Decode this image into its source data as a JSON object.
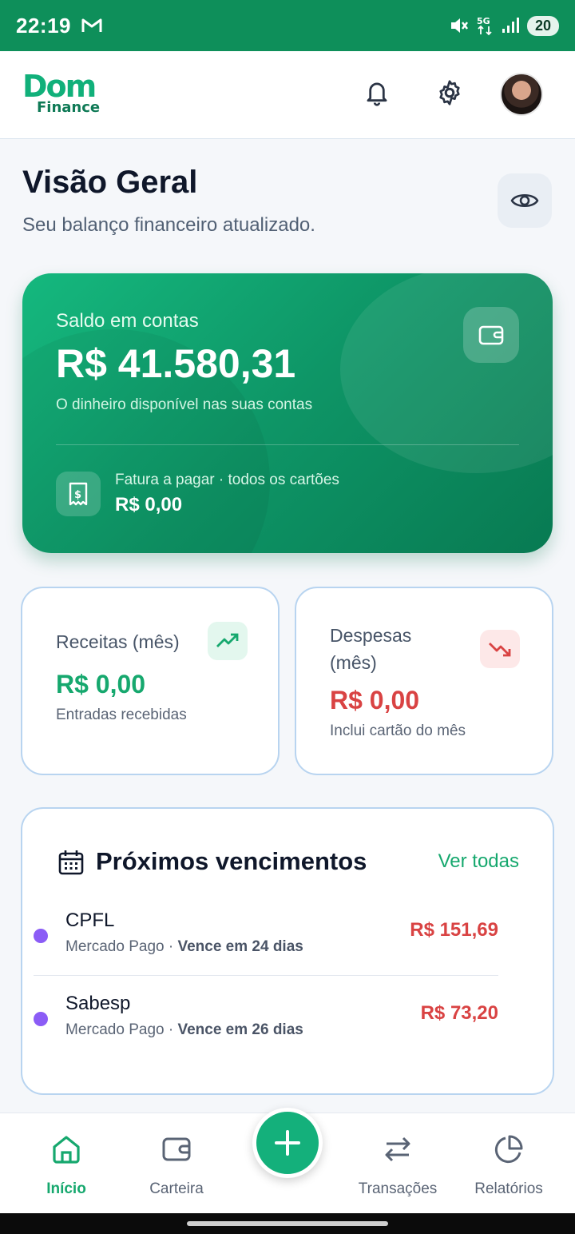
{
  "status_bar": {
    "time": "22:19",
    "battery": "20"
  },
  "header": {
    "logo_top": "Dom",
    "logo_bottom": "Finance"
  },
  "overview": {
    "title": "Visão Geral",
    "subtitle": "Seu balanço financeiro atualizado."
  },
  "balance": {
    "label": "Saldo em contas",
    "value": "R$ 41.580,31",
    "description": "O dinheiro disponível nas suas contas",
    "bill_label": "Fatura a pagar · todos os cartões",
    "bill_value": "R$ 0,00"
  },
  "income": {
    "label": "Receitas (mês)",
    "value": "R$ 0,00",
    "description": "Entradas recebidas",
    "color": "#16a86e"
  },
  "expense": {
    "label_line1": "Despesas",
    "label_line2": "(mês)",
    "value": "R$ 0,00",
    "description": "Inclui cartão do mês",
    "color": "#d94343"
  },
  "upcoming": {
    "title": "Próximos vencimentos",
    "see_all": "Ver todas",
    "items": [
      {
        "name": "CPFL",
        "source": "Mercado Pago",
        "due": "Vence em 24 dias",
        "amount": "R$ 151,69"
      },
      {
        "name": "Sabesp",
        "source": "Mercado Pago",
        "due": "Vence em 26 dias",
        "amount": "R$ 73,20"
      }
    ]
  },
  "nav": {
    "items": [
      {
        "label": "Início",
        "icon": "home-icon",
        "active": true
      },
      {
        "label": "Carteira",
        "icon": "wallet-icon",
        "active": false
      },
      {
        "label": "Transações",
        "icon": "arrows-swap-icon",
        "active": false
      },
      {
        "label": "Relatórios",
        "icon": "pie-chart-icon",
        "active": false
      }
    ],
    "fab_icon": "plus-icon"
  },
  "colors": {
    "primary": "#14b07b",
    "status_bar": "#0e8f5a",
    "danger": "#d94343"
  }
}
